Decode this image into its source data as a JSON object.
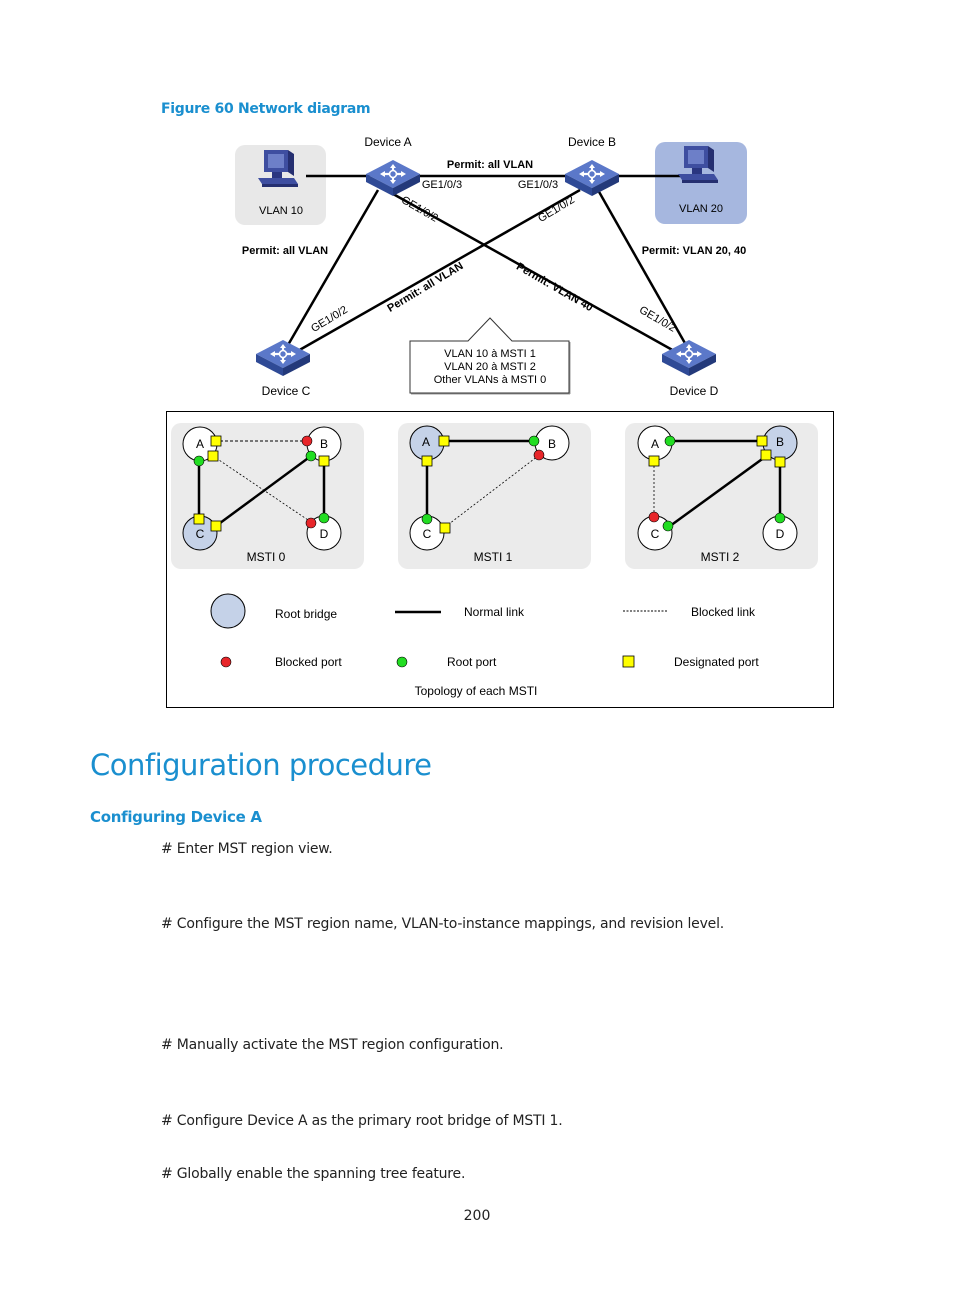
{
  "figure": {
    "caption": "Figure 60 Network diagram",
    "devices": {
      "a": "Device A",
      "b": "Device B",
      "c": "Device C",
      "d": "Device D"
    },
    "switch_badge": "SWITCH",
    "hosts": {
      "vlan10": "VLAN 10",
      "vlan20": "VLAN 20"
    },
    "ports": {
      "a_ge3": "GE1/0/3",
      "a_ge2": "GE1/0/2",
      "b_ge3": "GE1/0/3",
      "b_ge2": "GE1/0/2",
      "c_ge2": "GE1/0/2",
      "d_ge2": "GE1/0/2"
    },
    "links": {
      "a_b": "Permit: all VLAN",
      "a_c": "Permit: all VLAN",
      "b_c": "Permit: all VLAN",
      "a_d": "Permit: VLAN 40",
      "b_d": "Permit: VLAN 20, 40"
    },
    "callout": [
      "VLAN 10 à MSTI 1",
      "VLAN 20 à MSTI 2",
      "Other VLANs à MSTI 0"
    ],
    "msti": [
      {
        "label": "MSTI 0",
        "nodes": [
          "A",
          "B",
          "C",
          "D"
        ]
      },
      {
        "label": "MSTI 1",
        "nodes": [
          "A",
          "B",
          "C"
        ]
      },
      {
        "label": "MSTI 2",
        "nodes": [
          "A",
          "B",
          "C",
          "D"
        ]
      }
    ],
    "legend": {
      "root_bridge": "Root bridge",
      "normal_link": "Normal link",
      "blocked_link": "Blocked link",
      "blocked_port": "Blocked port",
      "root_port": "Root port",
      "designated_port": "Designated port",
      "title": "Topology of each MSTI"
    },
    "colors": {
      "root_bridge": "#c5d2e8",
      "blocked_port": "#e8262a",
      "root_port": "#22dd22",
      "designated_port": "#ffff00",
      "panel_bg": "#ebebeb",
      "vlan10_bg": "#e8e8e8",
      "vlan20_bg": "#a6b7df",
      "switch_blue": "#3b55a7"
    }
  },
  "section": {
    "title": "Configuration procedure",
    "subtitle": "Configuring Device A",
    "steps": [
      "# Enter MST region view.",
      "# Configure the MST region name, VLAN-to-instance mappings, and revision level.",
      "# Manually activate the MST region configuration.",
      "# Configure Device A as the primary root bridge of MSTI 1.",
      "# Globally enable the spanning tree feature."
    ]
  },
  "page_number": "200"
}
